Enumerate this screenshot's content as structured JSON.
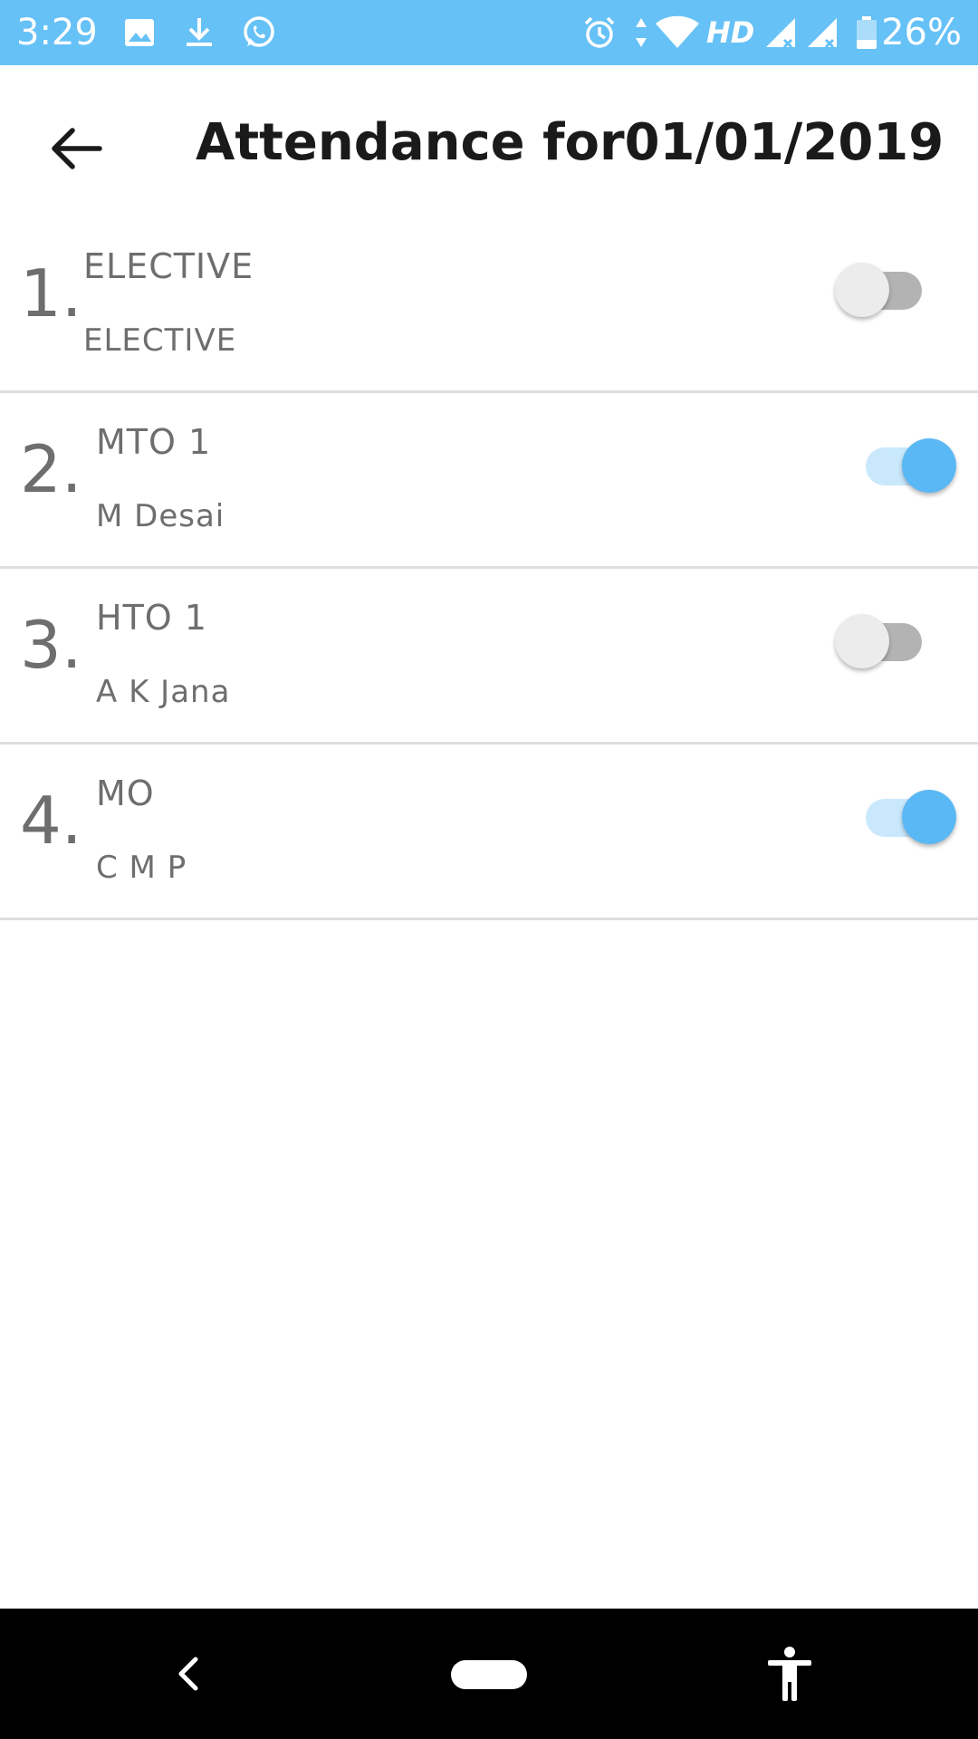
{
  "status_bar": {
    "time": "3:29",
    "battery_percent": "26%",
    "network_label": "HD",
    "background_color": "#66c1f6",
    "icons": [
      "image-icon",
      "download-icon",
      "whatsapp-icon",
      "alarm-icon",
      "data-arrows-icon",
      "wifi-icon",
      "signal-icon",
      "signal-icon",
      "battery-icon"
    ]
  },
  "app_bar": {
    "title": "Attendance for01/01/2019",
    "back_icon": "arrow-left-icon"
  },
  "attendance": {
    "items": [
      {
        "index": "1.",
        "title": "ELECTIVE",
        "subtitle": "ELECTIVE",
        "present": false
      },
      {
        "index": "2.",
        "title": "MTO 1",
        "subtitle": "M Desai",
        "present": true
      },
      {
        "index": "3.",
        "title": "HTO 1",
        "subtitle": "A K Jana",
        "present": false
      },
      {
        "index": "4.",
        "title": "MO",
        "subtitle": "C M P",
        "present": true
      }
    ]
  },
  "colors": {
    "accent": "#5ab8f5",
    "accent_track": "#c9e8fc",
    "off_thumb": "#ececec",
    "off_track": "#b3b3b3",
    "divider": "#dedede",
    "text_secondary": "#6e6e6e"
  },
  "nav_bar": {
    "icons": [
      "nav-back-icon",
      "nav-home-pill-icon",
      "accessibility-icon"
    ]
  }
}
